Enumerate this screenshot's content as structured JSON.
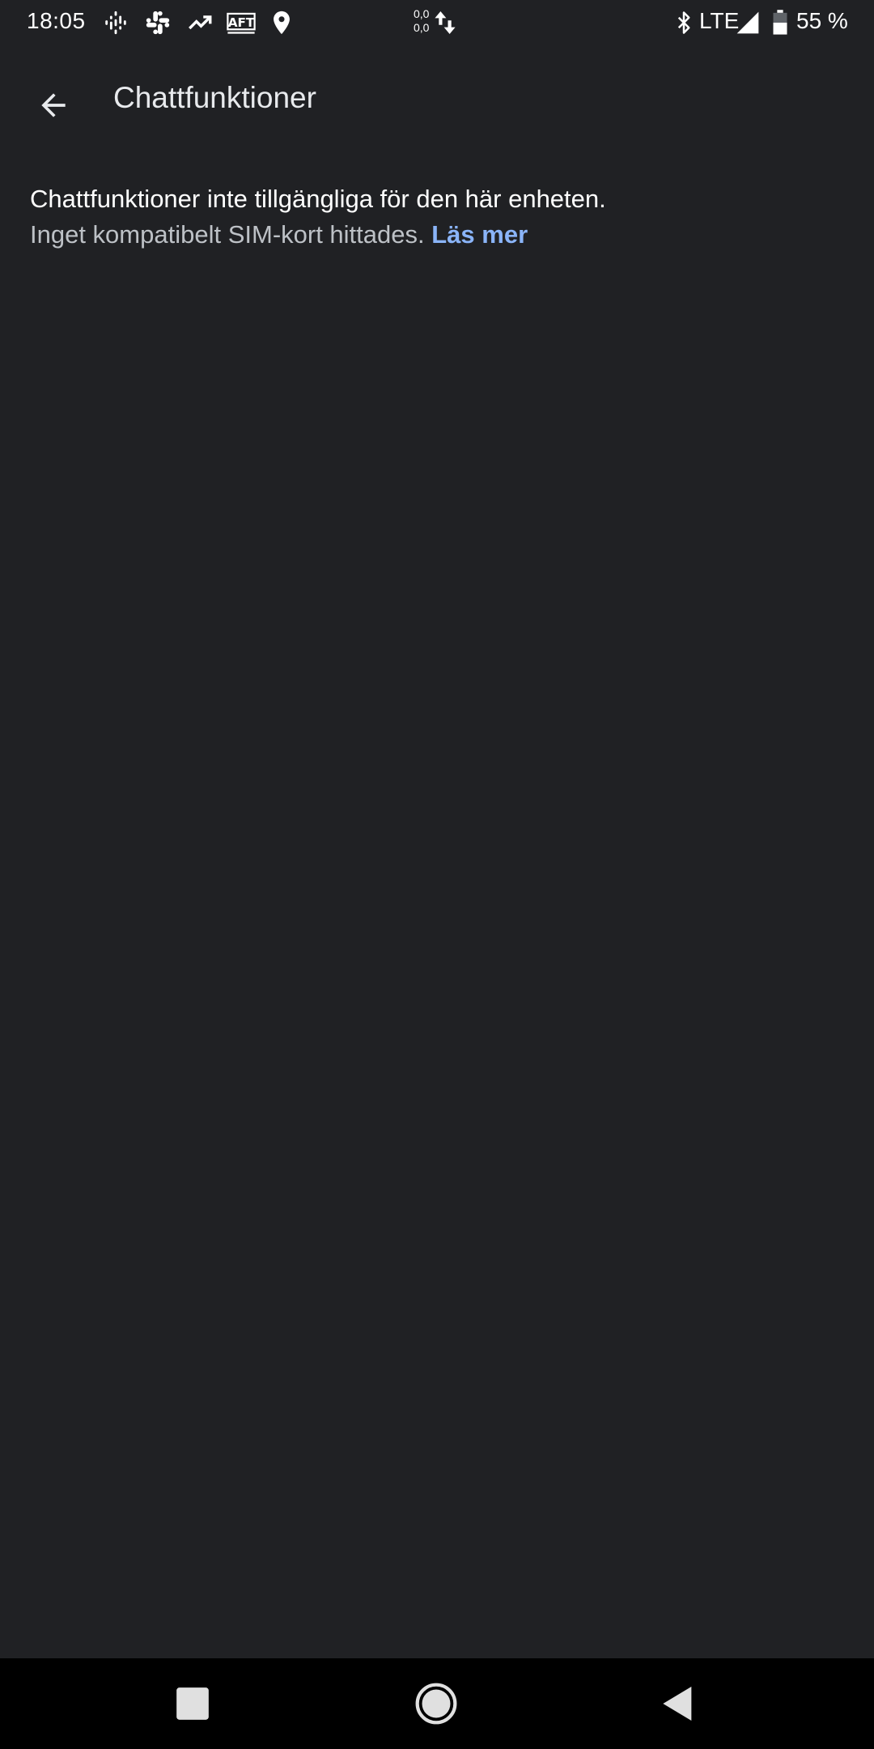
{
  "status_bar": {
    "time": "18:05",
    "icons": [
      "podcasts-icon",
      "slack-icon",
      "trending-up-icon",
      "aft-icon",
      "location-icon"
    ],
    "net_up": "0,0",
    "net_down": "0,0",
    "network": "LTE",
    "battery": "55 %"
  },
  "app_bar": {
    "back_icon": "arrow-back-icon",
    "title": "Chattfunktioner"
  },
  "content": {
    "primary": "Chattfunktioner inte tillgängliga för den här enheten.",
    "secondary": "Inget kompatibelt SIM-kort hittades.",
    "link": "Läs mer"
  },
  "colors": {
    "background": "#202124",
    "link": "#8ab4f8",
    "secondary_text": "#bdc1c6",
    "nav_bar": "#000000"
  },
  "nav_bar": {
    "buttons": [
      "recents-icon",
      "home-icon",
      "back-icon"
    ]
  }
}
